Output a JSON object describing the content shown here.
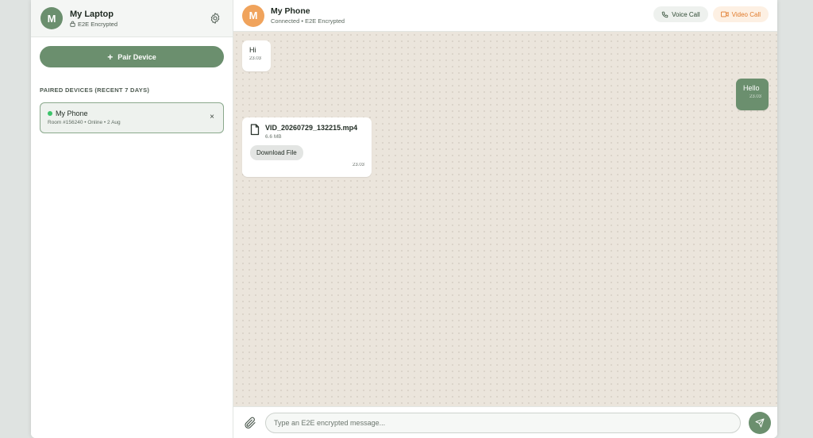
{
  "sidebar": {
    "avatar_initial": "M",
    "device_name": "My Laptop",
    "encryption": "E2E Encrypted",
    "pair_button_label": "Pair Device",
    "section_label": "PAIRED DEVICES (RECENT 7 DAYS)",
    "devices": [
      {
        "name": "My Phone",
        "meta": "Room #156240 • Online • 2 Aug",
        "close": "×"
      }
    ]
  },
  "chat": {
    "avatar_initial": "M",
    "name": "My Phone",
    "status": "Connected • E2E Encrypted",
    "voice_call_label": "Voice Call",
    "video_call_label": "Video Call",
    "messages": [
      {
        "text": "Hi",
        "time": "23.03"
      },
      {
        "text": "Hello",
        "time": "23.03"
      },
      {
        "file_name": "VID_20260729_132215.mp4",
        "file_size": "6.6 MB",
        "download_label": "Download File",
        "time": "23.03"
      }
    ],
    "input_placeholder": "Type an E2E encrypted message..."
  },
  "colors": {
    "accent": "#6b8f6e",
    "avatar_orange": "#f0a35c",
    "video_orange": "#e07a2b",
    "online": "#3cc46a"
  }
}
